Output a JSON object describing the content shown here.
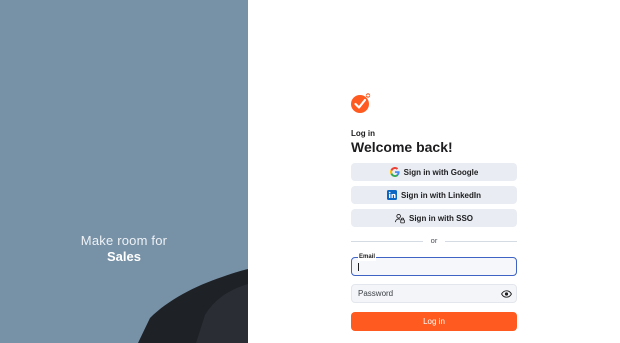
{
  "hero": {
    "tagline_line1": "Make room for",
    "tagline_line2": "Sales"
  },
  "brand": {
    "logo_icon": "checkmark-circle-logo",
    "accent_color": "#ff5a1f"
  },
  "login": {
    "eyebrow": "Log in",
    "title": "Welcome back!",
    "google_label": "Sign in with Google",
    "linkedin_label": "Sign in with LinkedIn",
    "sso_label": "Sign in with SSO",
    "divider_text": "or",
    "email_label": "Email",
    "email_value": "",
    "password_placeholder": "Password",
    "submit_label": "Log in"
  },
  "colors": {
    "left_panel": "#7791a6",
    "focus_border": "#3e63c5",
    "button_bg": "#e9edf3"
  }
}
